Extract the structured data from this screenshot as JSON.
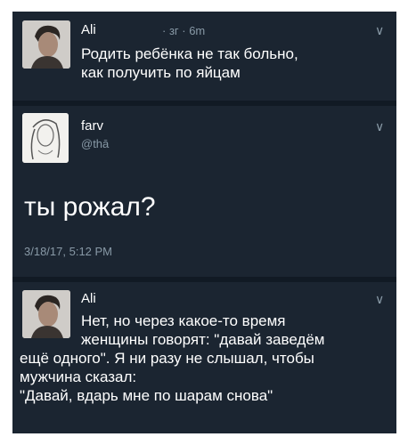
{
  "tweet1": {
    "name": "Ali",
    "time": "· зг · 6m",
    "text": "Родить ребёнка не так больно,\nкак получить по яйцам"
  },
  "tweet2": {
    "name": "farv",
    "handle": "@thā",
    "text": "ты рожал?",
    "timestamp": "3/18/17, 5:12 PM"
  },
  "tweet3": {
    "name": "Ali",
    "text_indented": "Нет, но через какое-то время\nженщины говорят: \"давай заведём",
    "text_full": "ещё одного\". Я ни разу не слышал, чтобы\nмужчина сказал:\n\"Давай, вдарь мне по шарам снова\""
  },
  "icons": {
    "menu": "chevron-down-icon"
  },
  "colors": {
    "background": "#1b2531",
    "separator": "#111a24",
    "meta": "#8899a6",
    "text": "#ffffff"
  }
}
